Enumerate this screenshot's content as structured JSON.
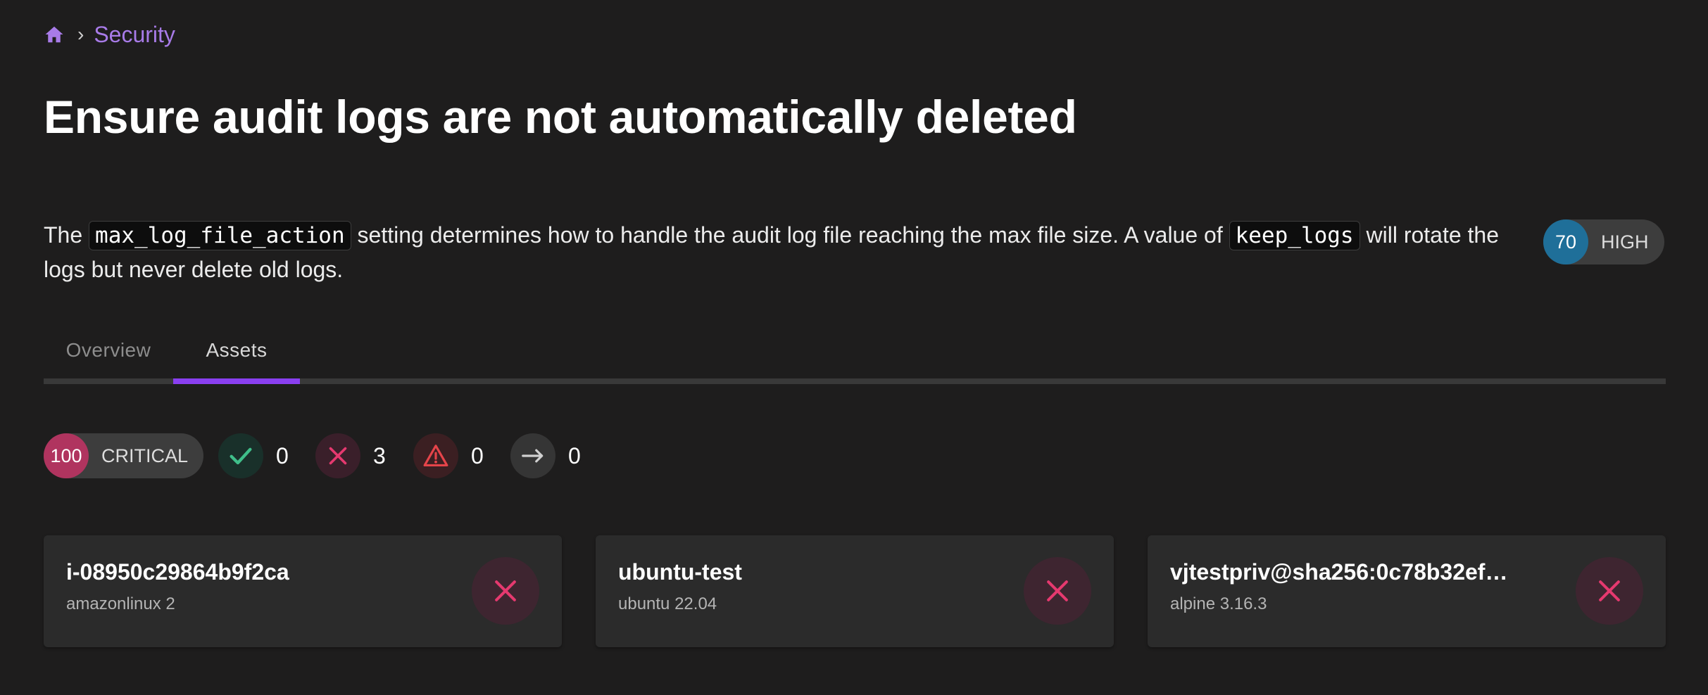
{
  "breadcrumb": {
    "home_icon": "home-icon",
    "separator": "›",
    "current": "Security"
  },
  "title": "Ensure audit logs are not automatically deleted",
  "description": {
    "part1": "The ",
    "code1": "max_log_file_action",
    "part2": " setting determines how to handle the audit log file reaching the max file size. A value of ",
    "code2": "keep_logs",
    "part3": " will rotate the logs but never delete old logs."
  },
  "check_score": {
    "value": "70",
    "label": "HIGH",
    "color": "#1f6f99"
  },
  "tabs": [
    {
      "label": "Overview",
      "active": false
    },
    {
      "label": "Assets",
      "active": true
    }
  ],
  "summary": {
    "score": {
      "value": "100",
      "label": "CRITICAL",
      "color": "#b0345f"
    },
    "pass": {
      "icon": "check-icon",
      "count": "0",
      "color": "#3fbf8a"
    },
    "fail": {
      "icon": "x-icon",
      "count": "3",
      "color": "#e5396f"
    },
    "error": {
      "icon": "warning-icon",
      "count": "0",
      "color": "#e5444a"
    },
    "skip": {
      "icon": "arrow-right-icon",
      "count": "0",
      "color": "#d0d0d0"
    }
  },
  "assets": [
    {
      "name": "i-08950c29864b9f2ca",
      "platform": "amazonlinux 2",
      "status": "fail",
      "icon": "x-icon"
    },
    {
      "name": "ubuntu-test",
      "platform": "ubuntu 22.04",
      "status": "fail",
      "icon": "x-icon"
    },
    {
      "name": "vjtestpriv@sha256:0c78b32ef…",
      "platform": "alpine 3.16.3",
      "status": "fail",
      "icon": "x-icon"
    }
  ],
  "colors": {
    "background": "#1e1d1d",
    "accent": "#8a3ff0",
    "link": "#a87be8",
    "card": "#2b2b2b"
  }
}
